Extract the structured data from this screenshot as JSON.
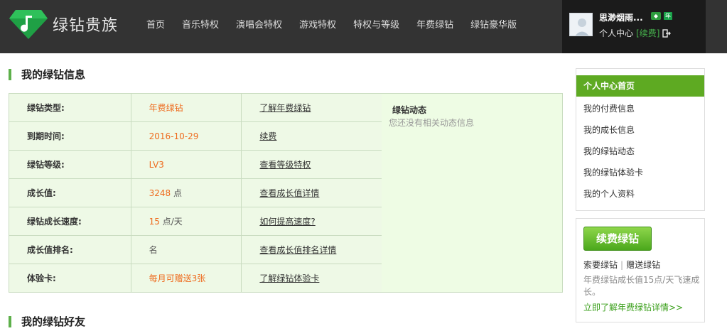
{
  "header": {
    "logo_text": "绿钻贵族",
    "nav": [
      "首页",
      "音乐特权",
      "演唱会特权",
      "游戏特权",
      "特权与等级",
      "年费绿钻",
      "绿钻豪华版"
    ],
    "user": {
      "name": "思渺烟雨...",
      "badge_year": "年",
      "center_label": "个人中心",
      "renew_label": "[续费]"
    }
  },
  "my_info": {
    "title": "我的绿钻信息",
    "rows": [
      {
        "label": "绿钻类型:",
        "value": "年费绿钻",
        "unit": "",
        "link": "了解年费绿钻"
      },
      {
        "label": "到期时间:",
        "value": "2016-10-29",
        "unit": "",
        "link": "续费"
      },
      {
        "label": "绿钻等级:",
        "value": "LV3",
        "unit": "",
        "link": "查看等级特权"
      },
      {
        "label": "成长值:",
        "value": "3248",
        "unit": " 点",
        "link": "查看成长值详情"
      },
      {
        "label": "绿钻成长速度:",
        "value": "15",
        "unit": " 点/天",
        "link": "如何提高速度?"
      },
      {
        "label": "成长值排名:",
        "value": "",
        "unit": "名",
        "link": "查看成长值排名详情"
      },
      {
        "label": "体验卡:",
        "value": "每月可赠送3张",
        "unit": "",
        "link": "了解绿钻体验卡"
      }
    ],
    "activity": {
      "title": "绿钻动态",
      "empty": "您还没有相关动态信息"
    }
  },
  "friends": {
    "title": "我的绿钻好友"
  },
  "sidebar": {
    "items": [
      "个人中心首页",
      "我的付费信息",
      "我的成长信息",
      "我的绿钻动态",
      "我的绿钻体验卡",
      "我的个人资料"
    ],
    "renew": {
      "button": "续费绿钻",
      "link_ask": "索要绿钻",
      "sep": "|",
      "link_gift": "赠送绿钻",
      "desc": "年费绿钻成长值15点/天飞速成长。",
      "more": "立即了解年费绿钻详情>>"
    }
  },
  "colors": {
    "header_bg": "#333333",
    "accent_green": "#5eaa22",
    "value_orange": "#ee6b1e",
    "table_bg": "#eef9e6"
  }
}
